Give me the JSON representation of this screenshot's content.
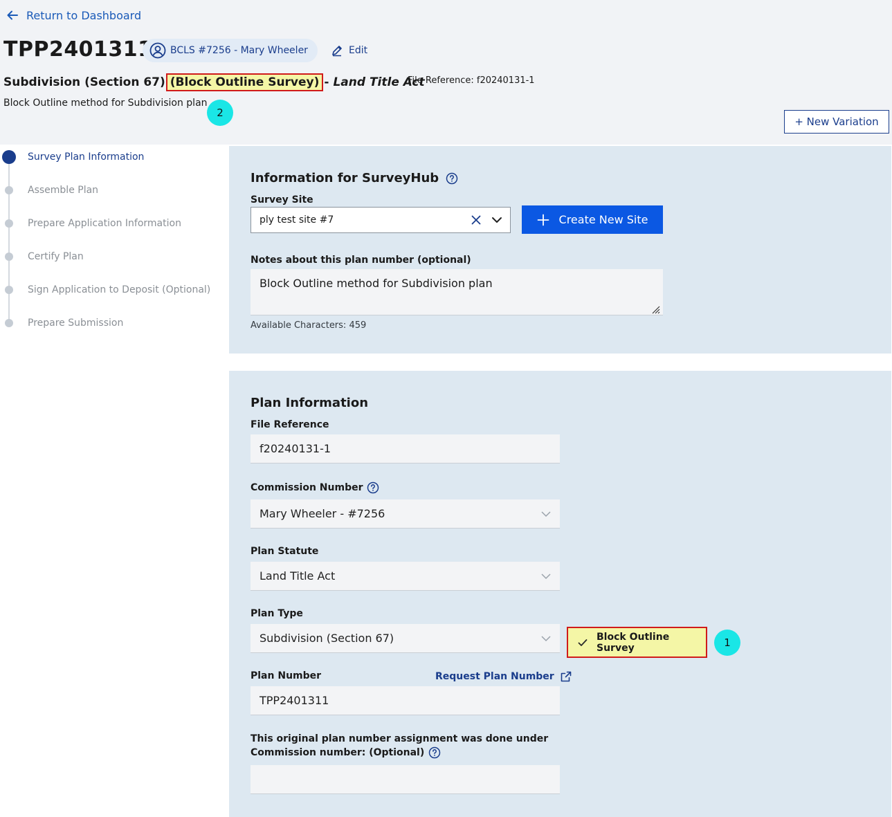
{
  "header": {
    "back_label": "Return to Dashboard",
    "plan_id": "TPP2401311",
    "owner_label": "BCLS #7256 - Mary Wheeler",
    "edit_label": "Edit",
    "subtitle_prefix": "Subdivision (Section 67)",
    "subtitle_highlight": "(Block Outline Survey)",
    "subtitle_dash": "-",
    "subtitle_act": "Land Title Act",
    "file_reference": "File Reference: f20240131-1",
    "description": "Block Outline method for Subdivision plan",
    "new_variation_label": "+ New Variation"
  },
  "annotations": {
    "badge_1": "1",
    "badge_2": "2"
  },
  "stepper": {
    "steps": [
      {
        "label": "Survey Plan Information",
        "active": true
      },
      {
        "label": "Assemble Plan",
        "active": false
      },
      {
        "label": "Prepare Application Information",
        "active": false
      },
      {
        "label": "Certify Plan",
        "active": false
      },
      {
        "label": "Sign Application to Deposit (Optional)",
        "active": false
      },
      {
        "label": "Prepare Submission",
        "active": false
      }
    ]
  },
  "surveyhub": {
    "title": "Information for SurveyHub",
    "survey_site_label": "Survey Site",
    "survey_site_value": "ply test site #7",
    "create_site_label": "Create New Site",
    "notes_label": "Notes about this plan number (optional)",
    "notes_value": "Block Outline method for Subdivision plan",
    "available_chars": "Available Characters: 459"
  },
  "plan_info": {
    "title": "Plan Information",
    "file_ref_label": "File Reference",
    "file_ref_value": "f20240131-1",
    "commission_label": "Commission Number",
    "commission_value": "Mary Wheeler - #7256",
    "statute_label": "Plan Statute",
    "statute_value": "Land Title Act",
    "type_label": "Plan Type",
    "type_value": "Subdivision (Section 67)",
    "bos_label": "Block Outline Survey",
    "plan_number_label": "Plan Number",
    "request_plan_label": "Request Plan Number",
    "plan_number_value": "TPP2401311",
    "orig_label_line1": "This original plan number assignment was done under",
    "orig_label_line2": "Commission number: (Optional)",
    "orig_value": ""
  },
  "colors": {
    "accent": "#1a3d8c",
    "primary_button": "#0b58e3",
    "panel_bg": "#dde8f1",
    "highlight": "#f4f6a6",
    "highlight_border": "#d01a1a",
    "badge": "#1ae6e6"
  }
}
